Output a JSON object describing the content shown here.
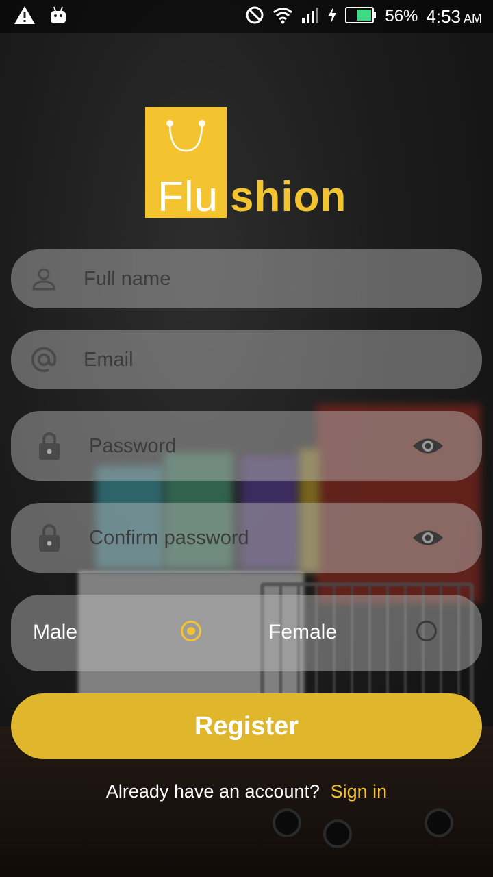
{
  "status_bar": {
    "battery": "56%",
    "time": "4:53",
    "ampm": "AM",
    "icons": [
      "warning-icon",
      "android-icon",
      "do-not-disturb-icon",
      "wifi-icon",
      "signal-icon",
      "charging-icon",
      "battery-icon"
    ]
  },
  "logo": {
    "part1": "Flu",
    "part2": "shion",
    "brand_color": "#f4c430"
  },
  "form": {
    "full_name_placeholder": "Full name",
    "email_placeholder": "Email",
    "password_placeholder": "Password",
    "confirm_password_placeholder": "Confirm password",
    "gender": {
      "male_label": "Male",
      "female_label": "Female",
      "selected": "Male"
    },
    "register_label": "Register"
  },
  "footer": {
    "prompt": "Already have an account?",
    "sign_in_label": "Sign in"
  },
  "colors": {
    "accent": "#f4c430",
    "button": "#e0b62c"
  }
}
